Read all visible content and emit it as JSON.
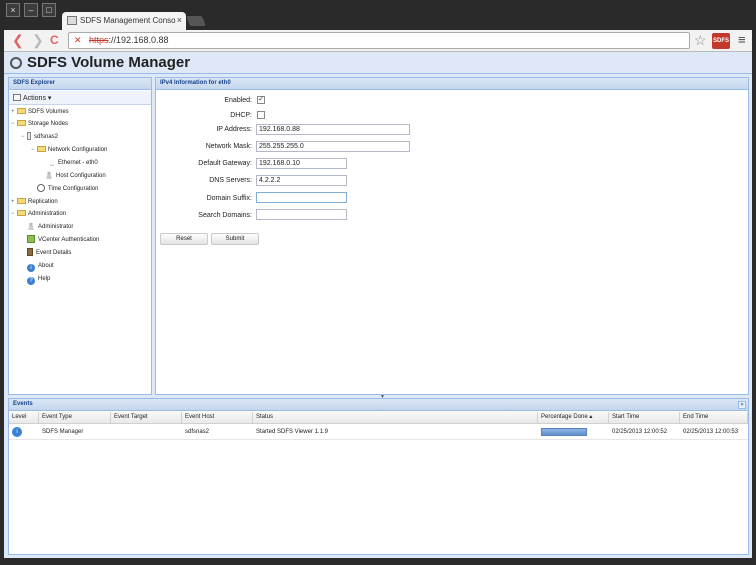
{
  "browser": {
    "window_buttons": [
      "×",
      "–",
      "□"
    ],
    "tab_title": "SDFS Management Conso",
    "tab_close": "×",
    "url_scheme": "https",
    "url_rest": "://192.168.0.88",
    "back_glyph": "❮",
    "forward_glyph": "❯",
    "reload_glyph": "C",
    "star_glyph": "☆",
    "menu_glyph": "≡",
    "extension_label": "SDFS"
  },
  "app": {
    "title": "SDFS Volume Manager"
  },
  "explorer": {
    "header": "SDFS Explorer",
    "actions_label": "Actions ▾",
    "tree": [
      {
        "label": "SDFS Volumes",
        "expander": "+",
        "icon": "folder"
      },
      {
        "label": "Storage Nodes",
        "expander": "−",
        "icon": "folder"
      },
      {
        "label": "sdfsnas2",
        "expander": "−",
        "icon": "server"
      },
      {
        "label": "Network Configuration",
        "expander": "−",
        "icon": "folder"
      },
      {
        "label": "Ethernet - eth0",
        "expander": "",
        "icon": "arrows"
      },
      {
        "label": "Host Configuration",
        "expander": "",
        "icon": "person"
      },
      {
        "label": "Time Configuration",
        "expander": "",
        "icon": "clock"
      },
      {
        "label": "Replication",
        "expander": "+",
        "icon": "folder"
      },
      {
        "label": "Administration",
        "expander": "−",
        "icon": "folder"
      },
      {
        "label": "Administrator",
        "expander": "",
        "icon": "person"
      },
      {
        "label": "VCenter Authentication",
        "expander": "",
        "icon": "vcenter"
      },
      {
        "label": "Event Details",
        "expander": "",
        "icon": "event"
      },
      {
        "label": "About",
        "expander": "",
        "icon": "info"
      },
      {
        "label": "Help",
        "expander": "",
        "icon": "help"
      }
    ]
  },
  "ipv4": {
    "header": "IPv4 Information for eth0",
    "enabled_label": "Enabled:",
    "enabled_checked": true,
    "dhcp_label": "DHCP:",
    "dhcp_checked": false,
    "ip_label": "IP Address:",
    "ip_value": "192.168.0.88",
    "mask_label": "Network Mask:",
    "mask_value": "255.255.255.0",
    "gateway_label": "Default Gateway:",
    "gateway_value": "192.168.0.10",
    "dns_label": "DNS Servers:",
    "dns_value": "4.2.2.2",
    "suffix_label": "Domain Suffix:",
    "suffix_value": "",
    "search_label": "Search Domains:",
    "search_value": "",
    "reset_label": "Reset",
    "submit_label": "Submit"
  },
  "events": {
    "header": "Events",
    "columns": [
      "Level",
      "Event Type",
      "Event Target",
      "Event Host",
      "Status",
      "Percentage Done ▴",
      "Start Time",
      "End Time"
    ],
    "rows": [
      {
        "level_icon": "i",
        "event_type": "SDFS Manager",
        "event_target": "",
        "event_host": "sdfsnas2",
        "status": "Started SDFS Viewer 1.1.9",
        "percentage_done": 100,
        "start_time": "02/25/2013 12:00:52",
        "end_time": "02/25/2013 12:00:53"
      }
    ]
  }
}
